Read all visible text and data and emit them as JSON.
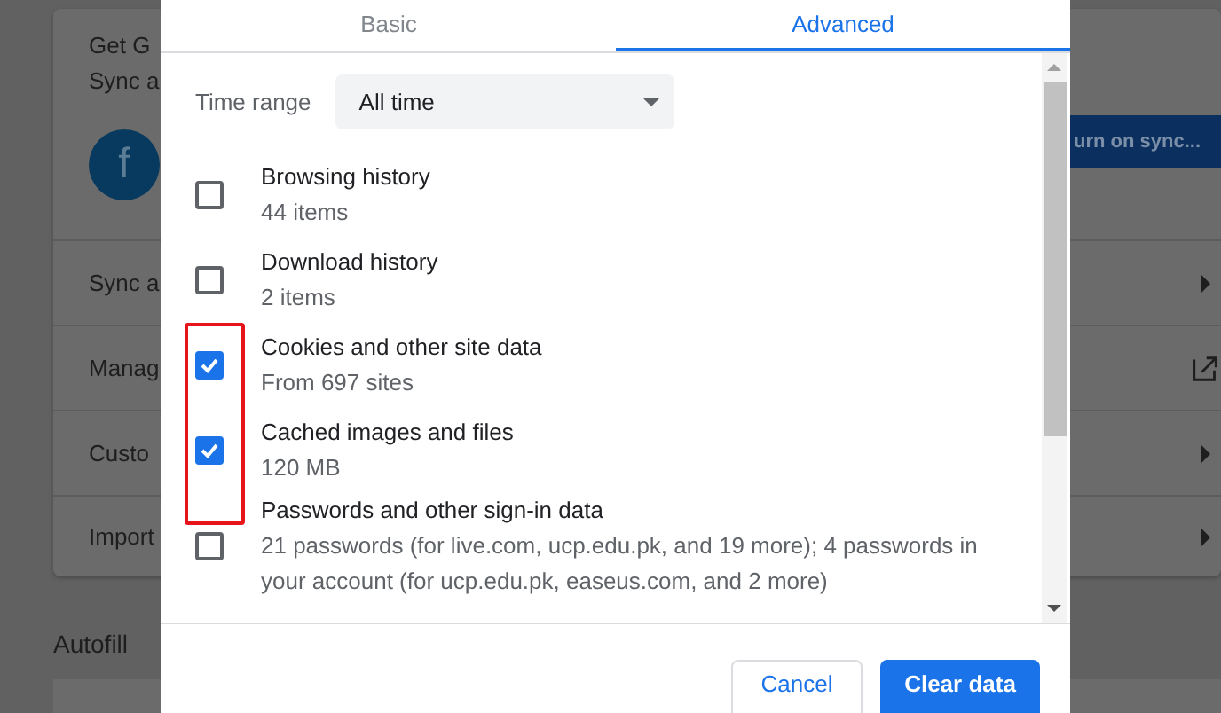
{
  "background": {
    "header_lines": [
      "Get G",
      "Sync a"
    ],
    "avatar_letter": "f",
    "sync_button": "urn on sync...",
    "rows": [
      {
        "label": "Sync a",
        "kind": "arrow"
      },
      {
        "label": "Manag",
        "kind": "external"
      },
      {
        "label": "Custo",
        "kind": "arrow"
      },
      {
        "label": "Import",
        "kind": "arrow"
      }
    ],
    "section_title": "Autofill"
  },
  "dialog": {
    "tabs": [
      {
        "label": "Basic",
        "selected": false
      },
      {
        "label": "Advanced",
        "selected": true
      }
    ],
    "time_range": {
      "label": "Time range",
      "value": "All time"
    },
    "items": [
      {
        "title": "Browsing history",
        "detail": "44 items",
        "checked": false
      },
      {
        "title": "Download history",
        "detail": "2 items",
        "checked": false
      },
      {
        "title": "Cookies and other site data",
        "detail": "From 697 sites",
        "checked": true
      },
      {
        "title": "Cached images and files",
        "detail": "120 MB",
        "checked": true
      },
      {
        "title": "Passwords and other sign-in data",
        "detail": "21 passwords (for live.com, ucp.edu.pk, and 19 more); 4 passwords in your account (for ucp.edu.pk, easeus.com, and 2 more)",
        "checked": false
      }
    ],
    "buttons": [
      {
        "label": "Cancel",
        "kind": "secondary"
      },
      {
        "label": "Clear data",
        "kind": "primary"
      }
    ]
  }
}
